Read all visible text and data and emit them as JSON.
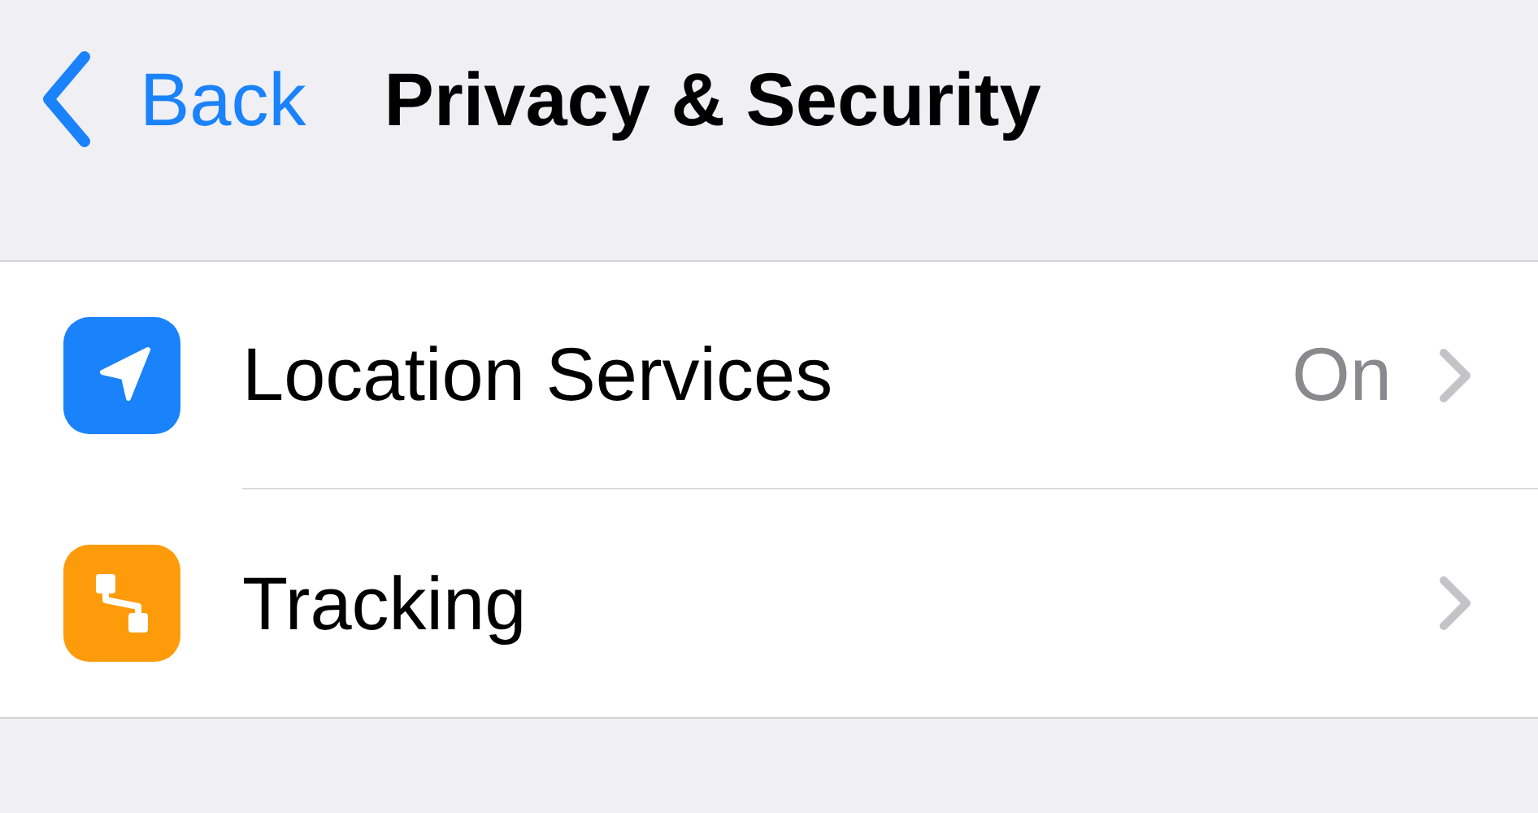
{
  "nav": {
    "back_label": "Back",
    "title": "Privacy & Security"
  },
  "rows": [
    {
      "kind": "location",
      "color": "#1a82fb",
      "label": "Location Services",
      "value": "On"
    },
    {
      "kind": "tracking",
      "color": "#fe9b0b",
      "label": "Tracking"
    }
  ]
}
